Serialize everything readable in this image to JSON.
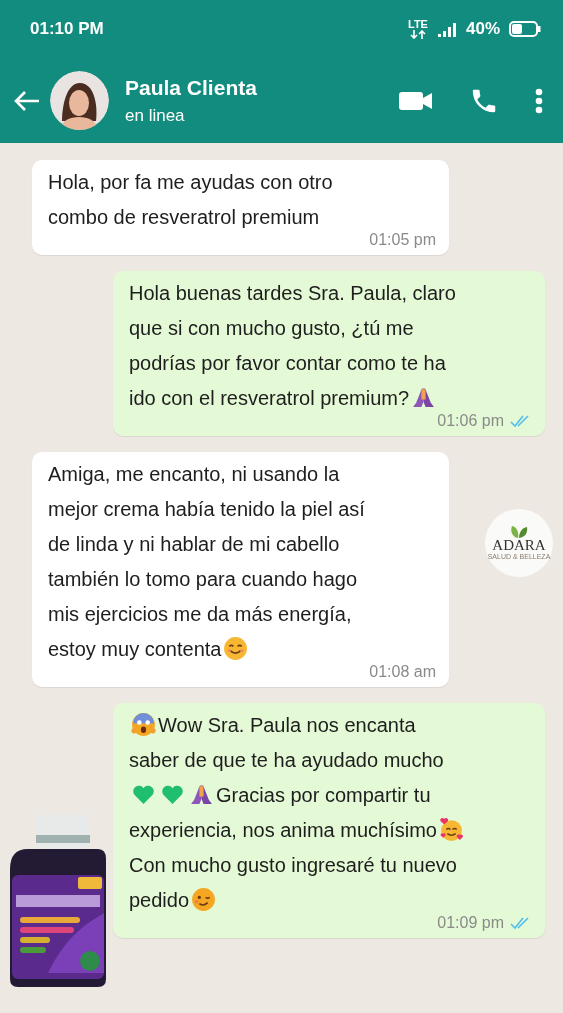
{
  "status_bar": {
    "time": "01:10 PM",
    "network": "LTE",
    "battery": "40%"
  },
  "header": {
    "name": "Paula Clienta",
    "status": "en linea"
  },
  "messages": [
    {
      "kind": "incoming",
      "parts": [
        {
          "kind": "text",
          "text": "Hola, por fa me ayudas con otro\ncombo de resveratrol premium"
        }
      ],
      "time": "01:05 pm"
    },
    {
      "kind": "outgoing",
      "parts": [
        {
          "kind": "text",
          "text": "Hola buenas tardes Sra. Paula, claro\nque si con mucho gusto, ¿tú me\npodrías por favor contar como te ha\nido con el resveratrol premium?"
        },
        {
          "kind": "pray"
        }
      ],
      "time": "01:06 pm",
      "read": true
    },
    {
      "kind": "incoming",
      "parts": [
        {
          "kind": "text",
          "text": "Amiga, me encanto, ni usando la\nmejor crema había tenido la piel así\nde linda y ni hablar de mi cabello\ntambién lo tomo para cuando hago\nmis ejercicios me da más energía,\nestoy muy contenta"
        },
        {
          "kind": "smile"
        }
      ],
      "time": "01:08 am"
    },
    {
      "kind": "outgoing",
      "parts": [
        {
          "kind": "scream"
        },
        {
          "kind": "text",
          "text": "Wow Sra. Paula nos encanta\nsaber de que te ha ayudado mucho\n"
        },
        {
          "kind": "heart"
        },
        {
          "kind": "heart"
        },
        {
          "kind": "pray"
        },
        {
          "kind": "text",
          "text": "Gracias por compartir tu\nexperiencia, nos anima muchísimo"
        },
        {
          "kind": "love"
        },
        {
          "kind": "text",
          "text": "\nCon mucho gusto ingresaré tu nuevo\npedido"
        },
        {
          "kind": "wink"
        }
      ],
      "time": "01:09 pm",
      "read": true
    }
  ],
  "logo": {
    "name": "ADARA",
    "tagline": "SALUD & BELLEZA"
  }
}
